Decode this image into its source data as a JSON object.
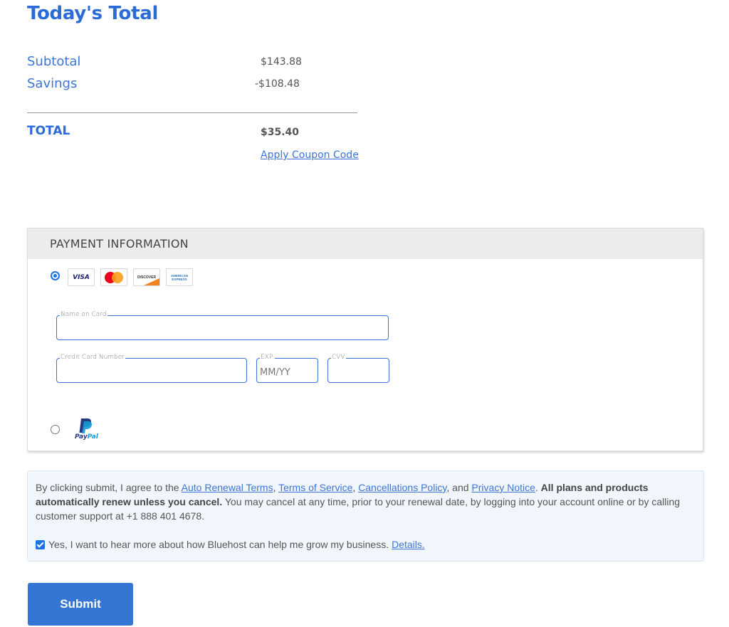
{
  "summary": {
    "title": "Today's Total",
    "subtotal_label": "Subtotal",
    "subtotal_value": "$143.88",
    "savings_label": "Savings",
    "savings_value": "-$108.48",
    "total_label": "TOTAL",
    "total_value": "$35.40",
    "coupon_link": "Apply Coupon Code"
  },
  "payment": {
    "header": "PAYMENT INFORMATION",
    "methods": [
      {
        "name": "credit-card",
        "selected": true
      },
      {
        "name": "paypal",
        "selected": false
      }
    ],
    "card_icons": {
      "visa": "VISA",
      "mastercard": "MasterCard",
      "discover": "DISCOVER",
      "amex_line1": "AMERICAN",
      "amex_line2": "EXPRESS"
    },
    "fields": {
      "name_label": "Name on Card",
      "name_value": "",
      "card_number_label": "Credit Card Number",
      "card_number_value": "",
      "exp_label": "EXP.",
      "exp_placeholder": "MM/YY",
      "cvv_label": "CVV",
      "cvv_value": ""
    },
    "paypal": {
      "pay": "Pay",
      "pal": "Pal"
    }
  },
  "terms": {
    "intro": "By clicking submit, I agree to the ",
    "link_auto_renewal": "Auto Renewal Terms",
    "sep1": ", ",
    "link_tos": "Terms of Service",
    "sep2": ", ",
    "link_cancellations": "Cancellations Policy",
    "sep3": ", and ",
    "link_privacy": "Privacy Notice",
    "sep4": ". ",
    "bold_text": "All plans and products automatically renew unless you cancel.",
    "rest": " You may cancel at any time, prior to your renewal date, by logging into your account online or by calling customer support at +1 888 401 4678.",
    "optin_checked": true,
    "optin_label": "Yes, I want to hear more about how Bluehost can help me grow my business.",
    "optin_details": "Details."
  },
  "submit_label": "Submit",
  "colors": {
    "brand_blue": "#2a6bd6",
    "link_blue": "#3d74d8",
    "button_blue": "#3575d3",
    "terms_bg": "#f1f6fd"
  }
}
